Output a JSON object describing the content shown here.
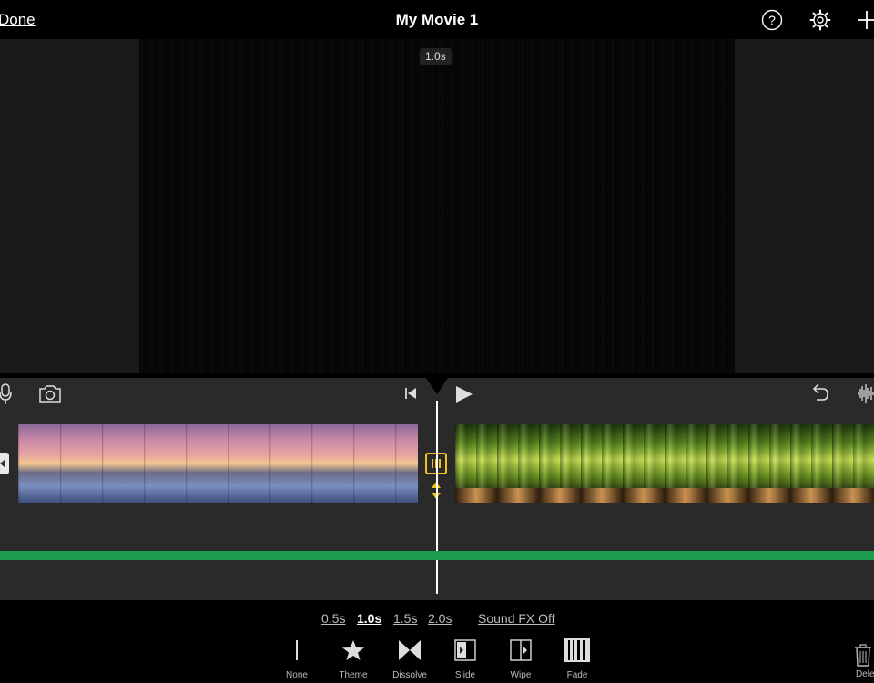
{
  "header": {
    "done_label": "Done",
    "title": "My Movie 1",
    "icons": [
      "help-icon",
      "settings-gear-icon",
      "add-icon"
    ]
  },
  "preview": {
    "duration_badge": "1.0s"
  },
  "timeline": {
    "icons": [
      "microphone-icon",
      "camera-icon",
      "skip-to-start-icon",
      "play-icon",
      "undo-icon",
      "audio-waveform-icon"
    ],
    "clips": [
      {
        "name": "sunset-clip",
        "thumbnail": "sunset-seascape"
      },
      {
        "name": "bamboo-forest-clip",
        "thumbnail": "bamboo-forest"
      }
    ],
    "audio_track_color": "#1f9d4f",
    "transition_color": "#f2c21b"
  },
  "transition_settings": {
    "durations": [
      "0.5s",
      "1.0s",
      "1.5s",
      "2.0s"
    ],
    "selected_duration": "1.0s",
    "sound_fx_label": "Sound FX Off",
    "styles": [
      {
        "label": "None",
        "icon": "none-line-icon"
      },
      {
        "label": "Theme",
        "icon": "star-icon"
      },
      {
        "label": "Dissolve",
        "icon": "dissolve-icon"
      },
      {
        "label": "Slide",
        "icon": "slide-icon"
      },
      {
        "label": "Wipe",
        "icon": "wipe-icon"
      },
      {
        "label": "Fade",
        "icon": "fade-icon"
      }
    ],
    "selected_style": "Fade",
    "delete_label": "Delete"
  }
}
